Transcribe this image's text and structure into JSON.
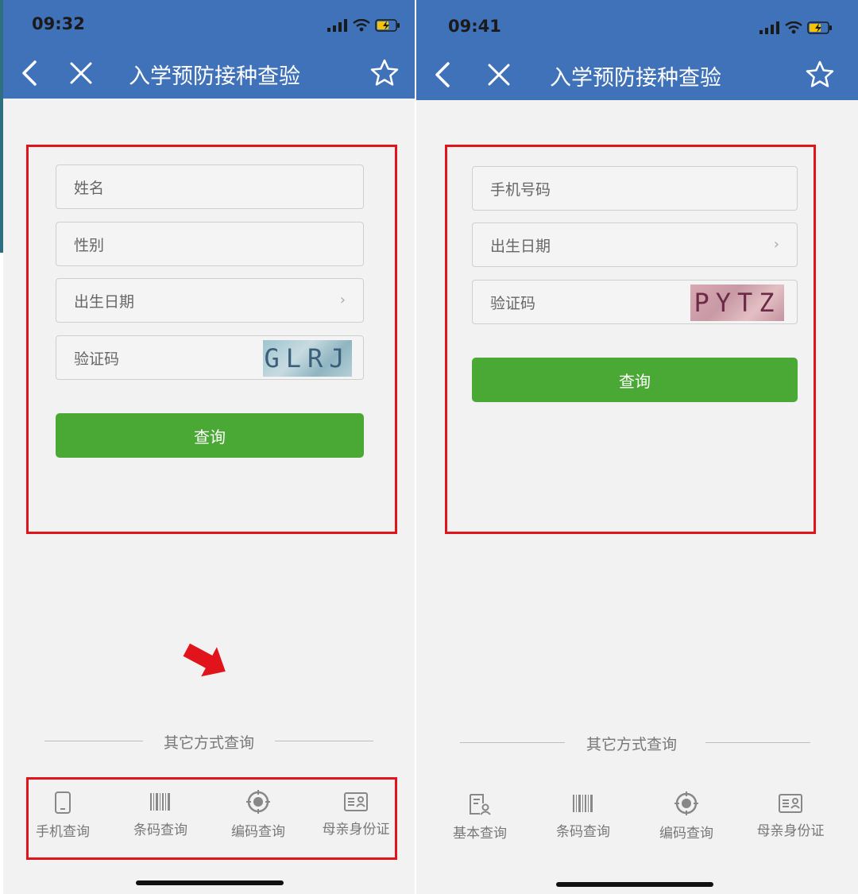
{
  "colors": {
    "header": "#3f72b9",
    "button": "#4aa934",
    "highlight": "#e1141b",
    "background": "#f2f2f2"
  },
  "left": {
    "status": {
      "time": "09:32",
      "icons": [
        "signal-icon",
        "wifi-icon",
        "battery-charging-icon"
      ]
    },
    "nav": {
      "title": "入学预防接种查验",
      "back_icon": "chevron-left-icon",
      "close_icon": "close-icon",
      "favorite_icon": "star-outline-icon"
    },
    "form": {
      "name": {
        "placeholder": "姓名"
      },
      "gender": {
        "placeholder": "性别"
      },
      "birthdate": {
        "placeholder": "出生日期",
        "chevron": "›"
      },
      "captcha": {
        "placeholder": "验证码",
        "code": "GLRJ"
      },
      "submit_label": "查询"
    },
    "other_methods": {
      "title": "其它方式查询",
      "items": [
        {
          "label": "手机查询",
          "icon": "phone-icon"
        },
        {
          "label": "条码查询",
          "icon": "barcode-icon"
        },
        {
          "label": "编码查询",
          "icon": "target-icon"
        },
        {
          "label": "母亲身份证",
          "icon": "id-card-icon"
        }
      ]
    }
  },
  "right": {
    "status": {
      "time": "09:41",
      "icons": [
        "signal-icon",
        "wifi-icon",
        "battery-charging-icon"
      ]
    },
    "nav": {
      "title": "入学预防接种查验",
      "back_icon": "chevron-left-icon",
      "close_icon": "close-icon",
      "favorite_icon": "star-outline-icon"
    },
    "form": {
      "phone": {
        "placeholder": "手机号码"
      },
      "birthdate": {
        "placeholder": "出生日期",
        "chevron": "›"
      },
      "captcha": {
        "placeholder": "验证码",
        "code": "PYTZ"
      },
      "submit_label": "查询"
    },
    "other_methods": {
      "title": "其它方式查询",
      "items": [
        {
          "label": "基本查询",
          "icon": "document-user-icon"
        },
        {
          "label": "条码查询",
          "icon": "barcode-icon"
        },
        {
          "label": "编码查询",
          "icon": "target-icon"
        },
        {
          "label": "母亲身份证",
          "icon": "id-card-icon"
        }
      ]
    }
  }
}
